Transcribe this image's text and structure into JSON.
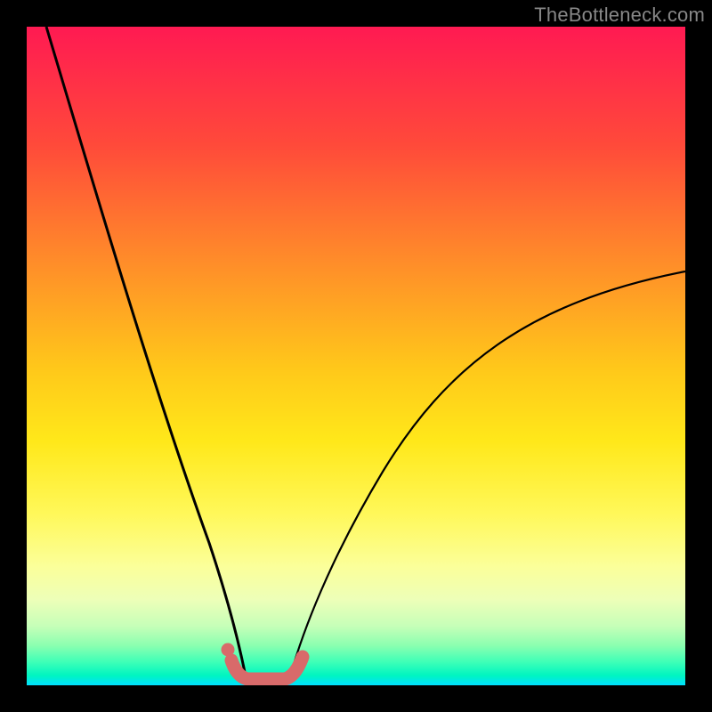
{
  "watermark": "TheBottleneck.com",
  "colors": {
    "frame": "#000000",
    "curve": "#000000",
    "marker": "#d86a6a",
    "gradient_top": "#ff1a52",
    "gradient_bottom": "#00e0ff"
  },
  "chart_data": {
    "type": "line",
    "title": "",
    "xlabel": "",
    "ylabel": "",
    "xlim": [
      0,
      100
    ],
    "ylim": [
      0,
      100
    ],
    "series": [
      {
        "name": "left-branch",
        "x": [
          3,
          8,
          12,
          16,
          20,
          23,
          26,
          28,
          30,
          31.5,
          33
        ],
        "y": [
          100,
          82,
          68,
          54,
          40,
          29,
          19,
          12,
          6,
          2.5,
          0.5
        ]
      },
      {
        "name": "right-branch",
        "x": [
          40,
          43,
          47,
          52,
          58,
          65,
          73,
          82,
          91,
          100
        ],
        "y": [
          0.5,
          4,
          11,
          20,
          30,
          39,
          47,
          54,
          59,
          63
        ]
      }
    ],
    "valley_markers": {
      "name": "valley-segment",
      "x": [
        31,
        33,
        35,
        37,
        39,
        41
      ],
      "y": [
        3,
        0.8,
        0.5,
        0.5,
        0.8,
        3
      ]
    },
    "valley_dot": {
      "x": 30.5,
      "y": 5
    }
  }
}
